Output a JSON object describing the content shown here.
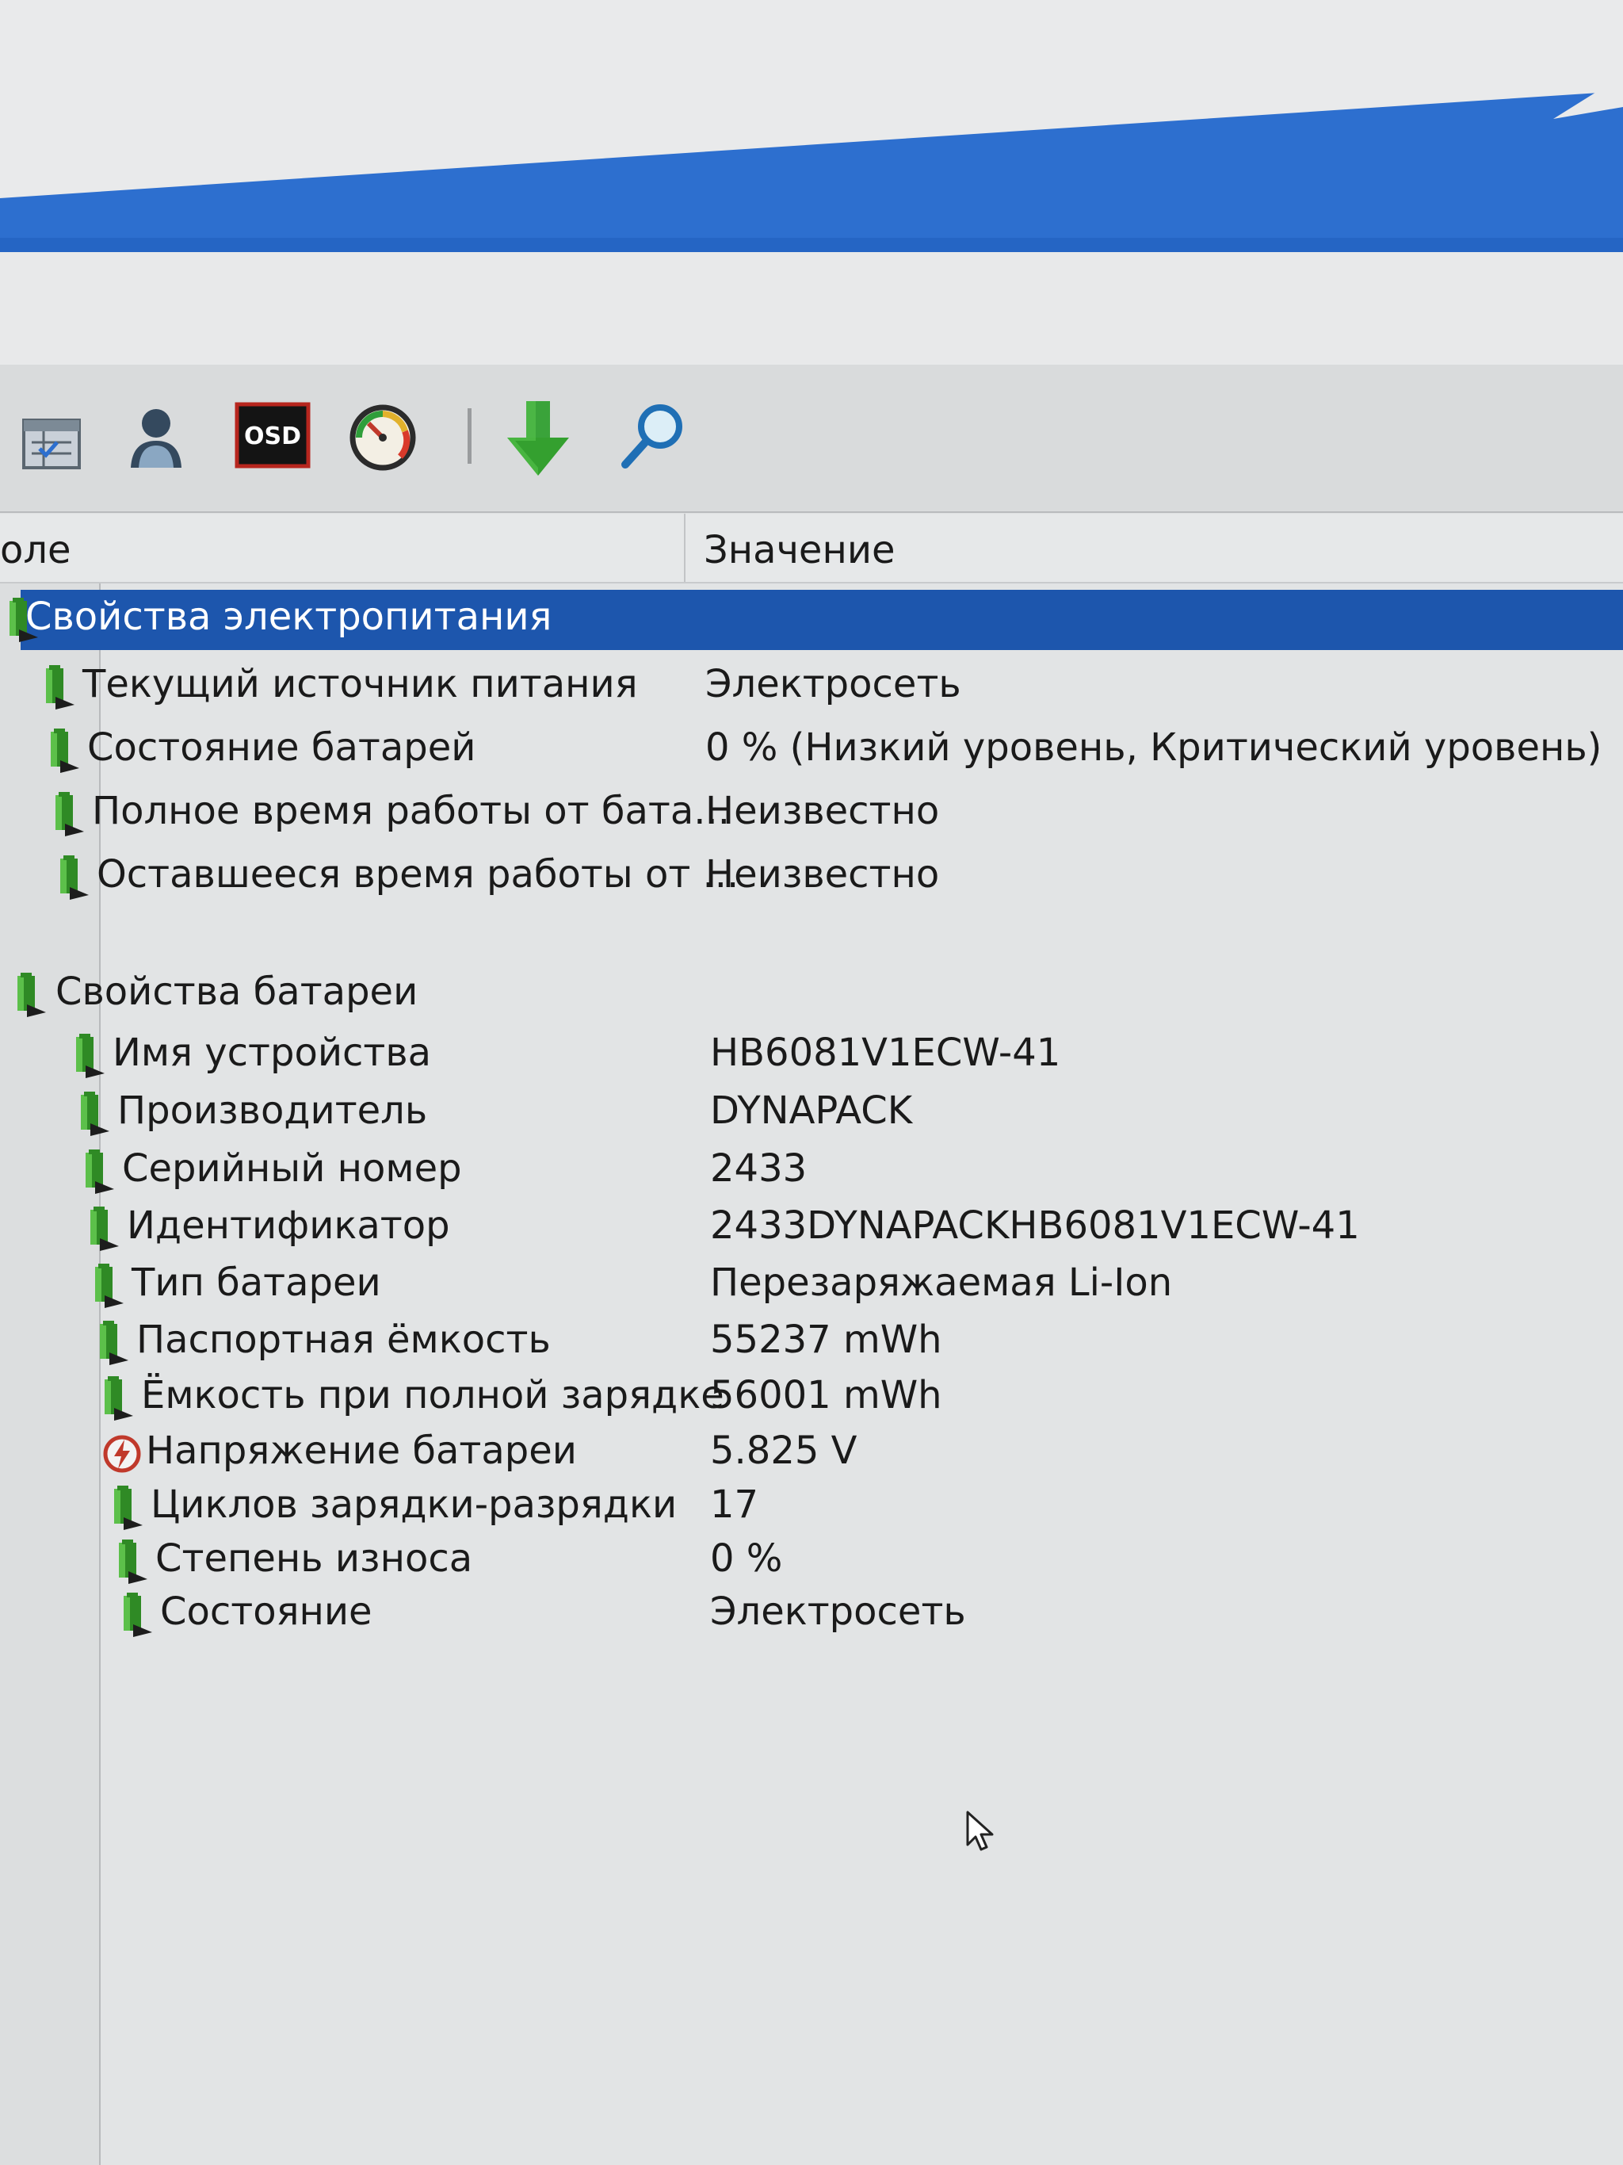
{
  "toolbar": {
    "buttons": [
      {
        "name": "report",
        "icon": "report-calendar-icon"
      },
      {
        "name": "user",
        "icon": "user-icon"
      },
      {
        "name": "osd",
        "icon": "osd-icon",
        "label": "OSD"
      },
      {
        "name": "benchmark",
        "icon": "gauge-icon"
      },
      {
        "name": "update",
        "icon": "download-arrow-icon"
      },
      {
        "name": "search",
        "icon": "magnifier-icon"
      }
    ]
  },
  "columns": {
    "field": "оле",
    "value": "Значение"
  },
  "groups": [
    {
      "title": "Свойства электропитания",
      "selected": true,
      "rows": [
        {
          "label": "Текущий источник питания",
          "value": "Электросеть"
        },
        {
          "label": "Состояние батарей",
          "value": "0 % (Низкий уровень, Критический уровень)"
        },
        {
          "label": "Полное время работы от бата...",
          "value": "Неизвестно"
        },
        {
          "label": "Оставшееся время работы от ...",
          "value": "Неизвестно"
        }
      ]
    },
    {
      "title": "Свойства батареи",
      "selected": false,
      "rows": [
        {
          "label": "Имя устройства",
          "value": "HB6081V1ECW-41"
        },
        {
          "label": "Производитель",
          "value": "DYNAPACK"
        },
        {
          "label": "Серийный номер",
          "value": "2433"
        },
        {
          "label": "Идентификатор",
          "value": "2433DYNAPACKHB6081V1ECW-41"
        },
        {
          "label": "Тип батареи",
          "value": "Перезаряжаемая Li-Ion"
        },
        {
          "label": "Паспортная ёмкость",
          "value": "55237 mWh"
        },
        {
          "label": "Ёмкость при полной зарядке",
          "value": "56001 mWh"
        },
        {
          "label": "Напряжение батареи",
          "value": "5.825 V",
          "icon": "voltage-icon"
        },
        {
          "label": "Циклов зарядки-разрядки",
          "value": "17"
        },
        {
          "label": "Степень износа",
          "value": "0 %"
        },
        {
          "label": "Состояние",
          "value": "Электросеть"
        }
      ]
    }
  ],
  "colors": {
    "selection": "#1d56ad",
    "titlebar_blue": "#2a6fd1",
    "battery_green": "#3a8f2a"
  }
}
